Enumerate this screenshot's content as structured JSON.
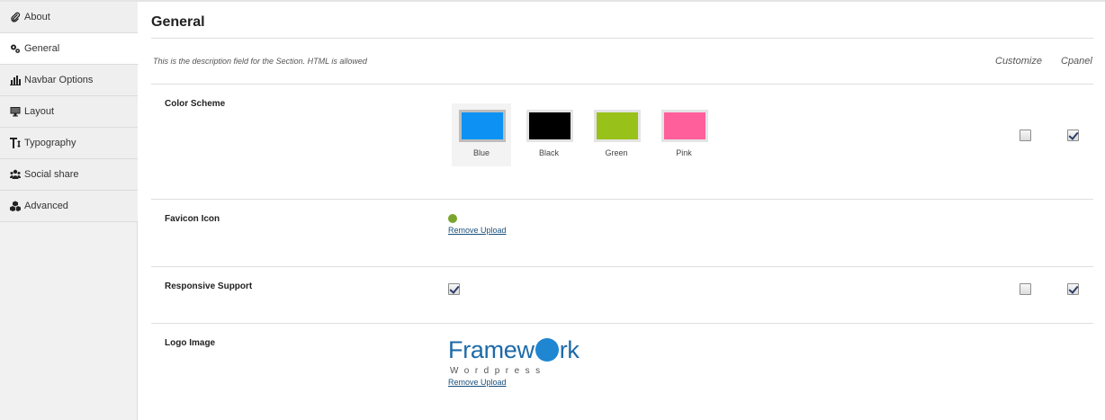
{
  "sidebar": {
    "items": [
      {
        "label": "About",
        "icon": "paperclip-icon"
      },
      {
        "label": "General",
        "icon": "gears-icon",
        "active": true
      },
      {
        "label": "Navbar Options",
        "icon": "bar-chart-icon"
      },
      {
        "label": "Layout",
        "icon": "monitor-icon"
      },
      {
        "label": "Typography",
        "icon": "text-height-icon"
      },
      {
        "label": "Social share",
        "icon": "group-icon"
      },
      {
        "label": "Advanced",
        "icon": "cubes-icon"
      }
    ]
  },
  "section": {
    "title": "General",
    "description": "This is the description field for the Section. HTML is allowed",
    "columns": [
      "Customize",
      "Cpanel"
    ]
  },
  "color_scheme": {
    "label": "Color Scheme",
    "selected": "Blue",
    "options": [
      {
        "name": "Blue",
        "color": "#0d92f4"
      },
      {
        "name": "Black",
        "color": "#000000"
      },
      {
        "name": "Green",
        "color": "#98c11a"
      },
      {
        "name": "Pink",
        "color": "#ff5f9b"
      }
    ],
    "customize": false,
    "cpanel": true
  },
  "favicon": {
    "label": "Favicon Icon",
    "remove_label": "Remove Upload"
  },
  "responsive": {
    "label": "Responsive Support",
    "enabled": true,
    "customize": false,
    "cpanel": true
  },
  "logo": {
    "label": "Logo Image",
    "text_before": "Framew",
    "text_after": "rk",
    "subtext": "Wordpress",
    "remove_label": "Remove Upload"
  }
}
